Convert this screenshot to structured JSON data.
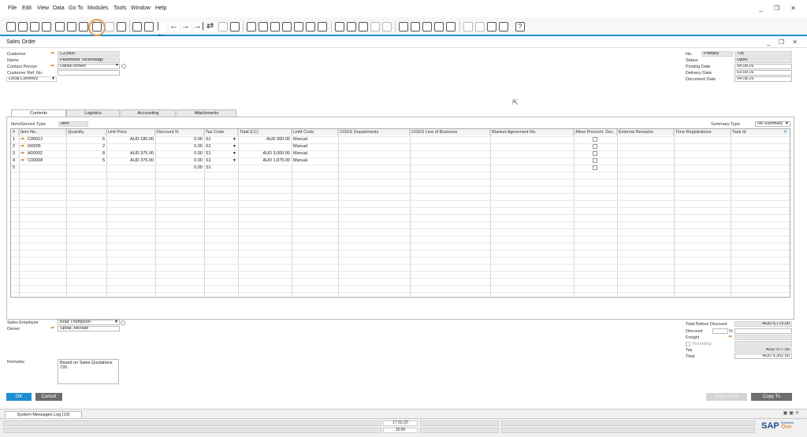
{
  "menu": [
    "File",
    "Edit",
    "View",
    "Data",
    "Go To",
    "Modules",
    "Tools",
    "Window",
    "Help"
  ],
  "window_controls": "_ ❐ ✕",
  "form": {
    "title": "Sales Order",
    "controls": "_ ❐ ✕"
  },
  "header_left": {
    "customer_label": "Customer",
    "customer_value": "C23900",
    "name_label": "Name",
    "name_value": "Parameter Technology",
    "contact_label": "Contact Person",
    "contact_value": "Daniel Brown",
    "ref_label": "Customer Ref. No.",
    "ref_value": "",
    "currency_value": "Local Currency"
  },
  "header_right": {
    "no_label": "No.",
    "no_series": "Primary",
    "no_value": "736",
    "status_label": "Status",
    "status_value": "Open",
    "posting_label": "Posting Date",
    "posting_value": "04.08.16",
    "delivery_label": "Delivery Date",
    "delivery_value": "03.09.16",
    "document_label": "Document Date",
    "document_value": "04.08.16"
  },
  "tabs": [
    "Contents",
    "Logistics",
    "Accounting",
    "Attachments"
  ],
  "contents": {
    "item_type_label": "Item/Service Type",
    "item_type_value": "Item",
    "summary_label": "Summary Type",
    "summary_value": "No Summary",
    "columns": [
      "#",
      "Item No.",
      "Quantity",
      "Unit Price",
      "Discount %",
      "Tax Code",
      "Total (LC)",
      "UoM Code",
      "COGS Departments",
      "COGS Line of Business",
      "Blanket Agreement No.",
      "Allow Procmnt. Doc.",
      "External Remarks",
      "Time Registrations",
      "Task Id"
    ],
    "rows": [
      {
        "n": "1",
        "item": "C00012",
        "qty": "5",
        "price": "AUD 180.00",
        "disc": "0.00",
        "tax": "S1",
        "total": "AUD 900.00",
        "uom": "Manual"
      },
      {
        "n": "2",
        "item": "I00005",
        "qty": "2",
        "price": "",
        "disc": "0.00",
        "tax": "S1",
        "total": "",
        "uom": "Manual"
      },
      {
        "n": "3",
        "item": "A00002",
        "qty": "8",
        "price": "AUD 375.00",
        "disc": "0.00",
        "tax": "S1",
        "total": "AUD 3,000.00",
        "uom": "Manual"
      },
      {
        "n": "4",
        "item": "C00008",
        "qty": "5",
        "price": "AUD 375.00",
        "disc": "0.00",
        "tax": "S1",
        "total": "AUD 1,875.00",
        "uom": "Manual"
      },
      {
        "n": "5",
        "item": "",
        "qty": "",
        "price": "",
        "disc": "0.00",
        "tax": "S1",
        "total": "",
        "uom": ""
      }
    ]
  },
  "footer_left": {
    "employee_label": "Sales Employee",
    "employee_value": "Brad Thompson",
    "owner_label": "Owner",
    "owner_value": "Spear, Michael",
    "remarks_label": "Remarks",
    "remarks_value": "Based on Sales Quotations 726."
  },
  "totals": {
    "before_discount_label": "Total Before Discount",
    "before_discount_value": "AUD 5,775.00",
    "discount_label": "Discount",
    "discount_pct_sign": "%",
    "freight_label": "Freight",
    "rounding_label": "Rounding",
    "tax_label": "Tax",
    "tax_value": "AUD 577.50",
    "total_label": "Total",
    "total_value": "AUD 6,352.50"
  },
  "buttons": {
    "ok": "OK",
    "cancel": "Cancel",
    "copy_from": "Copy From",
    "copy_to": "Copy To"
  },
  "status": {
    "tab": "System Messages Log (10)",
    "date": "17.02.20",
    "time": "15:00",
    "brand": "SAP",
    "brand_sub1": "Business",
    "brand_sub2": "One"
  },
  "colors": {
    "accent": "#1f8fd1",
    "ok_button": "#1f8fd1",
    "link_arrow": "#d07a1a",
    "highlight_ring": "#e39a55"
  }
}
